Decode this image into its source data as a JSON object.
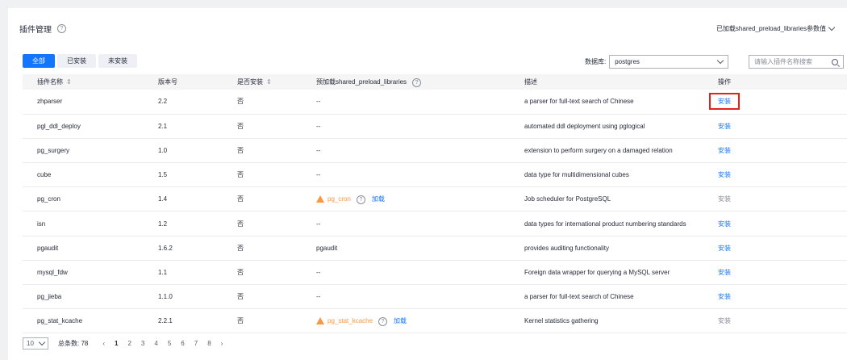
{
  "header": {
    "title": "插件管理",
    "help_icon": "?",
    "right_label": "已加载shared_preload_libraries参数值"
  },
  "tabs": [
    {
      "label": "全部",
      "active": true
    },
    {
      "label": "已安装",
      "active": false
    },
    {
      "label": "未安装",
      "active": false
    }
  ],
  "filter": {
    "db_label": "数据库:",
    "db_value": "postgres",
    "search_placeholder": "请输入插件名称搜索"
  },
  "table": {
    "columns": [
      "插件名称",
      "版本号",
      "是否安装",
      "预加载shared_preload_libraries",
      "描述",
      "操作"
    ],
    "rows": [
      {
        "name": "zhparser",
        "version": "2.2",
        "installed": "否",
        "preload": "--",
        "preload_type": "text",
        "desc": "a parser for full-text search of Chinese",
        "action": "安装",
        "action_state": "link-highlight"
      },
      {
        "name": "pgl_ddl_deploy",
        "version": "2.1",
        "installed": "否",
        "preload": "--",
        "preload_type": "text",
        "desc": "automated ddl deployment using pglogical",
        "action": "安装",
        "action_state": "link"
      },
      {
        "name": "pg_surgery",
        "version": "1.0",
        "installed": "否",
        "preload": "--",
        "preload_type": "text",
        "desc": "extension to perform surgery on a damaged relation",
        "action": "安装",
        "action_state": "link"
      },
      {
        "name": "cube",
        "version": "1.5",
        "installed": "否",
        "preload": "--",
        "preload_type": "text",
        "desc": "data type for multidimensional cubes",
        "action": "安装",
        "action_state": "link"
      },
      {
        "name": "pg_cron",
        "version": "1.4",
        "installed": "否",
        "preload": "pg_cron",
        "preload_type": "warn",
        "load_label": "加载",
        "desc": "Job scheduler for PostgreSQL",
        "action": "安装",
        "action_state": "disabled"
      },
      {
        "name": "isn",
        "version": "1.2",
        "installed": "否",
        "preload": "--",
        "preload_type": "text",
        "desc": "data types for international product numbering standards",
        "action": "安装",
        "action_state": "link"
      },
      {
        "name": "pgaudit",
        "version": "1.6.2",
        "installed": "否",
        "preload": "pgaudit",
        "preload_type": "text",
        "desc": "provides auditing functionality",
        "action": "安装",
        "action_state": "link"
      },
      {
        "name": "mysql_fdw",
        "version": "1.1",
        "installed": "否",
        "preload": "--",
        "preload_type": "text",
        "desc": "Foreign data wrapper for querying a MySQL server",
        "action": "安装",
        "action_state": "link"
      },
      {
        "name": "pg_jieba",
        "version": "1.1.0",
        "installed": "否",
        "preload": "--",
        "preload_type": "text",
        "desc": "a parser for full-text search of Chinese",
        "action": "安装",
        "action_state": "link"
      },
      {
        "name": "pg_stat_kcache",
        "version": "2.2.1",
        "installed": "否",
        "preload": "pg_stat_kcache",
        "preload_type": "warn",
        "load_label": "加载",
        "desc": "Kernel statistics gathering",
        "action": "安装",
        "action_state": "disabled"
      }
    ]
  },
  "pager": {
    "page_size": "10",
    "total_label": "总条数: 78",
    "pages": [
      "1",
      "2",
      "3",
      "4",
      "5",
      "6",
      "7",
      "8"
    ],
    "current": "1"
  },
  "colors": {
    "primary": "#1476ff",
    "warn": "#fa9841",
    "highlight": "#e2231a"
  }
}
